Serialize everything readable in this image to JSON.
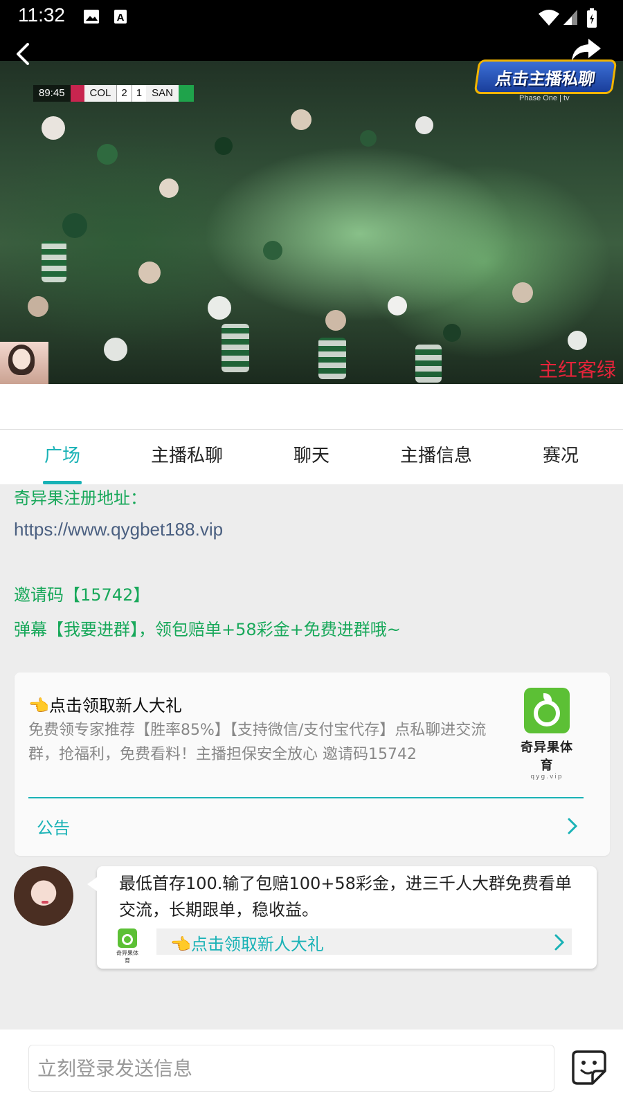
{
  "status_bar": {
    "time": "11:32"
  },
  "video": {
    "scoreboard": {
      "clock": "89:45",
      "home": "COL",
      "home_score": "2",
      "away_score": "1",
      "away": "SAN"
    },
    "promo_badge": "点击主播私聊",
    "broadcast_tag": "Phase One | tv",
    "watermark": "主红客绿"
  },
  "tabs": [
    {
      "label": "广场",
      "active": true
    },
    {
      "label": "主播私聊"
    },
    {
      "label": "聊天"
    },
    {
      "label": "主播信息"
    },
    {
      "label": "赛况"
    }
  ],
  "feed": {
    "register_label": "奇异果注册地址：",
    "register_url": "https://www.qygbet188.vip",
    "invite_code": "邀请码【15742】",
    "danmaku_tip": "弹幕【我要进群】，领包赔单+58彩金+免费进群哦~",
    "card": {
      "title": "👈点击领取新人大礼",
      "description": "免费领专家推荐【胜率85%】【支持微信/支付宝代存】点私聊进交流群，抢福利，免费看料！主播担保安全放心 邀请码15742",
      "logo_name": "奇异果体育",
      "logo_sub": "qyg.vip",
      "notice_label": "公告"
    },
    "message": {
      "text": "最低首存100.输了包赔100+58彩金，进三千人大群免费看单交流，长期跟单，稳收益。",
      "mini_logo_text": "奇异果体育",
      "link_label": "👈点击领取新人大礼"
    }
  },
  "chat": {
    "placeholder": "立刻登录发送信息"
  },
  "colors": {
    "accent": "#19b2b6",
    "green_text": "#18a85a",
    "brand_green": "#5cc035"
  }
}
